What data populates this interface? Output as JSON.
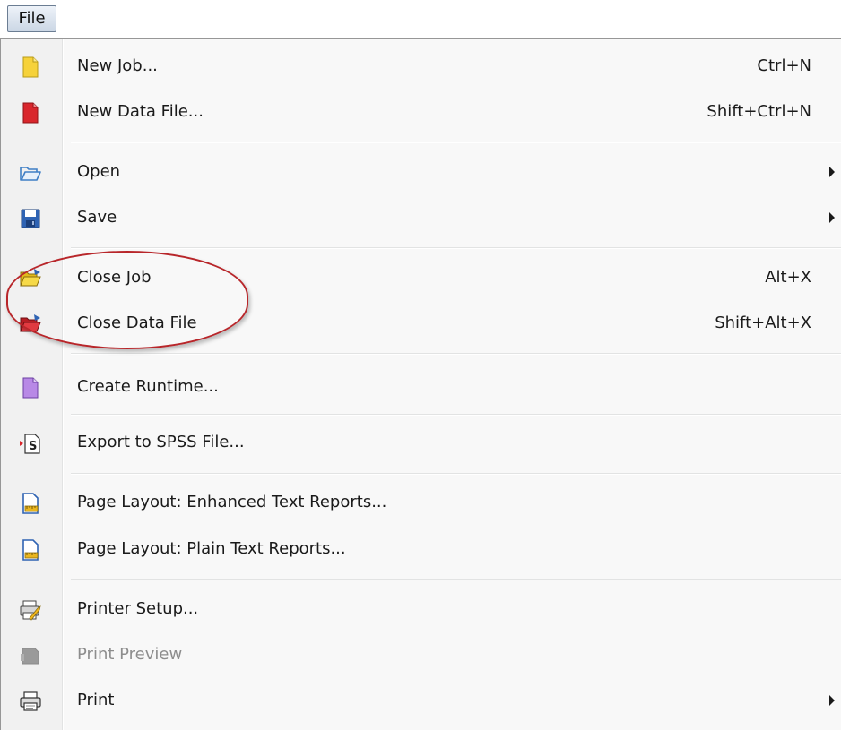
{
  "menubar": {
    "file_label": "File"
  },
  "menu": {
    "items": [
      {
        "label": "New Job...",
        "shortcut": "Ctrl+N",
        "icon": "new-job-icon"
      },
      {
        "label": "New Data File...",
        "shortcut": "Shift+Ctrl+N",
        "icon": "new-data-file-icon"
      },
      {
        "label": "Open",
        "icon": "open-folder-icon",
        "has_submenu": true
      },
      {
        "label": "Save",
        "icon": "floppy-disk-icon",
        "has_submenu": true
      },
      {
        "label": "Close Job",
        "shortcut": "Alt+X",
        "icon": "close-job-folder-icon"
      },
      {
        "label": "Close Data File",
        "shortcut": "Shift+Alt+X",
        "icon": "close-data-file-folder-icon"
      },
      {
        "label": "Create Runtime...",
        "icon": "runtime-document-icon"
      },
      {
        "label": "Export to SPSS File...",
        "icon": "spss-export-icon"
      },
      {
        "label": "Page Layout: Enhanced Text Reports...",
        "icon": "page-layout-ruler-icon"
      },
      {
        "label": "Page Layout: Plain Text Reports...",
        "icon": "page-layout-ruler-icon"
      },
      {
        "label": "Printer Setup...",
        "icon": "printer-setup-wrench-icon"
      },
      {
        "label": "Print Preview",
        "icon": "print-preview-icon",
        "disabled": true
      },
      {
        "label": "Print",
        "icon": "printer-icon",
        "has_submenu": true
      }
    ]
  },
  "colors": {
    "highlight_ring": "#b8262a",
    "disabled_text": "#8d8d8d",
    "icon_gutter": "#f1f1f1"
  }
}
